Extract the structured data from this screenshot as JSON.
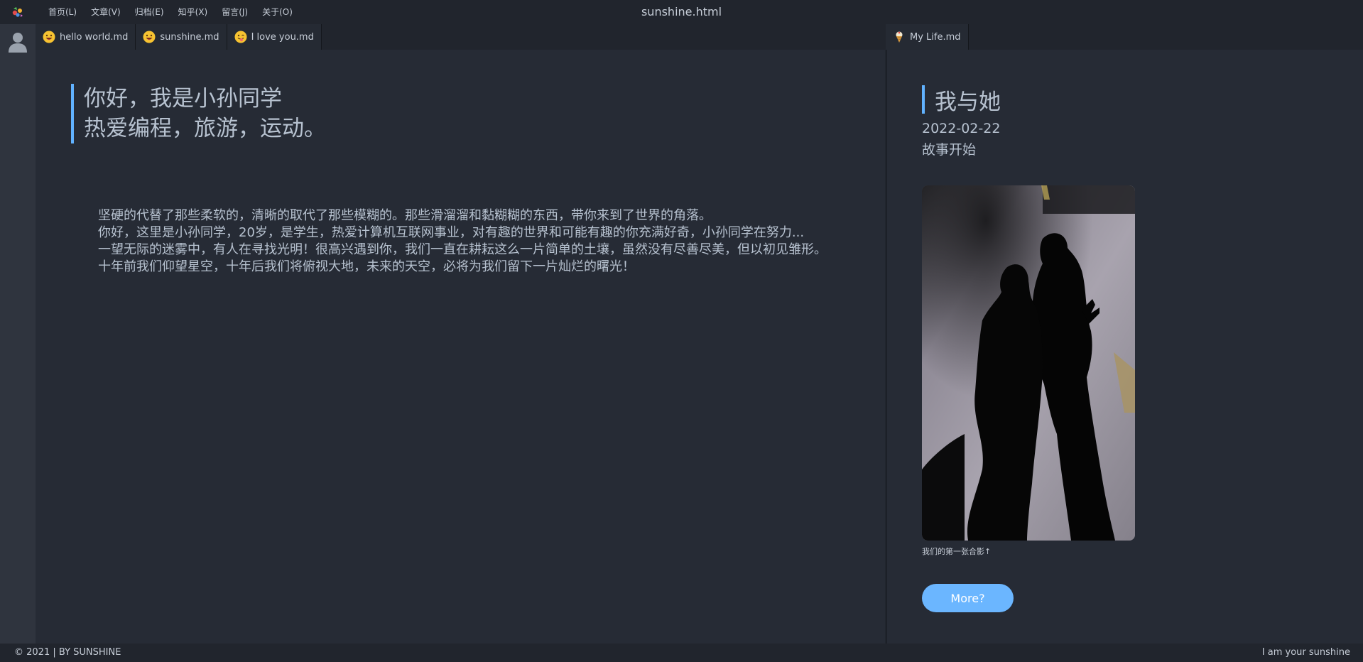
{
  "window": {
    "title": "sunshine.html"
  },
  "menu": {
    "items": [
      "首页(L)",
      "文章(V)",
      "归档(E)",
      "知乎(X)",
      "留言(J)",
      "关于(O)"
    ]
  },
  "tabs_left": [
    {
      "label": "hello world.md",
      "icon": "grinning-face-icon"
    },
    {
      "label": "sunshine.md",
      "icon": "grinning-face-icon"
    },
    {
      "label": "I love you.md",
      "icon": "winking-tongue-face-icon"
    }
  ],
  "tabs_right": [
    {
      "label": "My Life.md",
      "icon": "ice-cream-icon"
    }
  ],
  "main": {
    "intro": [
      "你好，我是小孙同学",
      "热爱编程，旅游，运动。"
    ],
    "paragraph": [
      "坚硬的代替了那些柔软的，清晰的取代了那些模糊的。那些滑溜溜和黏糊糊的东西，带你来到了世界的角落。",
      "你好，这里是小孙同学，20岁，是学生，热爱计算机互联网事业，对有趣的世界和可能有趣的你充满好奇，小孙同学在努力...",
      "一望无际的迷雾中，有人在寻找光明！很高兴遇到你，我们一直在耕耘这么一片简单的土壤，虽然没有尽善尽美，但以初见雏形。",
      "十年前我们仰望星空，十年后我们将俯视大地，未来的天空，必将为我们留下一片灿烂的曙光！"
    ]
  },
  "side": {
    "title": "我与她",
    "date": "2022-02-22",
    "subtitle": "故事开始",
    "caption": "我们的第一张合影↑",
    "more_label": "More?"
  },
  "status": {
    "left": "© 2021 | BY SUNSHINE",
    "right": "I am your sunshine"
  },
  "colors": {
    "accent": "#61b2ff",
    "button": "#6bb6ff",
    "background": "#262b35",
    "bar": "#21252d"
  }
}
